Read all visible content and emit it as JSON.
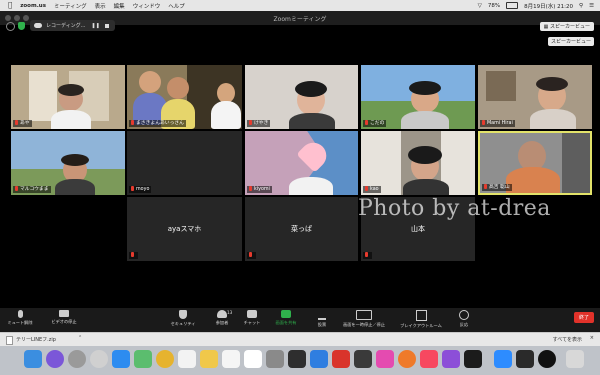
{
  "menubar": {
    "app": "zoom.us",
    "items": [
      "ミーティング",
      "表示",
      "編集",
      "ウィンドウ",
      "ヘルプ"
    ],
    "battery": "78%",
    "datetime": "8月19日(水)  21:20"
  },
  "window": {
    "title": "Zoomミーティング",
    "recording_label": "レコーディング...",
    "view_button": "スピーカービュー",
    "speaker_view_hint": "スピーカービュー"
  },
  "participants": [
    {
      "name": "あや",
      "video": true
    },
    {
      "name": "まさきよんあいっさん",
      "video": true
    },
    {
      "name": "けやき",
      "video": true
    },
    {
      "name": "こだの",
      "video": true
    },
    {
      "name": "Mami Hirai",
      "video": true
    },
    {
      "name": "マルコウまま",
      "video": true
    },
    {
      "name": "moyo",
      "video": false
    },
    {
      "name": "kiyomi",
      "video": true
    },
    {
      "name": "kao",
      "video": true
    },
    {
      "name": "髙吉 聡山",
      "video": true,
      "active_speaker": true
    },
    {
      "name": "ayaスマホ",
      "video": false
    },
    {
      "name": "菜っぱ",
      "video": false
    },
    {
      "name": "山本",
      "video": false
    }
  ],
  "watermark": "Photo by at-drea",
  "toolbar": {
    "mute": "ミュート解除",
    "video": "ビデオの停止",
    "security": "セキュリティ",
    "participants": "参加者",
    "participants_count": "13",
    "chat": "チャット",
    "share": "画面を共有",
    "polls": "投票",
    "record": "画面を一時停止／停止",
    "breakout": "ブレイクアウトルーム",
    "reactions": "反応",
    "end": "終了"
  },
  "downloadbar": {
    "file": "テリーLINEフ.zip",
    "show_all": "すべてを表示"
  },
  "colors": {
    "active_border": "#e3e36a",
    "end_button": "#e1322a",
    "share_green": "#2fb14c",
    "muted_red": "#e63b2e"
  }
}
